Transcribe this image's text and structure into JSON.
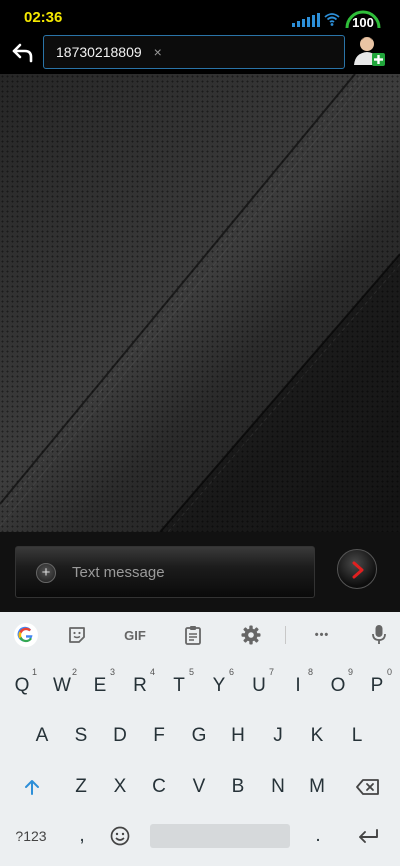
{
  "status_bar": {
    "time": "02:36",
    "battery_level": "100",
    "time_color": "#f4e800",
    "signal_icon": "signal-bars-icon",
    "wifi_icon": "wifi-icon"
  },
  "header": {
    "back_icon": "back-arrow-icon",
    "recipient": "18730218809",
    "clear_glyph": "×",
    "add_contact_icon": "add-contact-icon",
    "accent_color": "#2a74a8"
  },
  "composer": {
    "attach_glyph": "+",
    "placeholder": "Text message",
    "send_icon": "send-arrow-icon"
  },
  "keyboard": {
    "toolbar": {
      "google_icon": "google-icon",
      "sticker_icon": "sticker-icon",
      "gif_label": "GIF",
      "clipboard_icon": "clipboard-icon",
      "settings_icon": "gear-icon",
      "more_glyph": "•••",
      "mic_icon": "mic-icon"
    },
    "row1": [
      {
        "key": "Q",
        "hint": "1"
      },
      {
        "key": "W",
        "hint": "2"
      },
      {
        "key": "E",
        "hint": "3"
      },
      {
        "key": "R",
        "hint": "4"
      },
      {
        "key": "T",
        "hint": "5"
      },
      {
        "key": "Y",
        "hint": "6"
      },
      {
        "key": "U",
        "hint": "7"
      },
      {
        "key": "I",
        "hint": "8"
      },
      {
        "key": "O",
        "hint": "9"
      },
      {
        "key": "P",
        "hint": "0"
      }
    ],
    "row2": [
      "A",
      "S",
      "D",
      "F",
      "G",
      "H",
      "J",
      "K",
      "L"
    ],
    "row3": [
      "Z",
      "X",
      "C",
      "V",
      "B",
      "N",
      "M"
    ],
    "shift_icon": "shift-arrow-icon",
    "backspace_icon": "backspace-icon",
    "symbols_label": "?123",
    "comma": ",",
    "emoji_icon": "emoji-icon",
    "period": ".",
    "enter_icon": "enter-icon"
  }
}
